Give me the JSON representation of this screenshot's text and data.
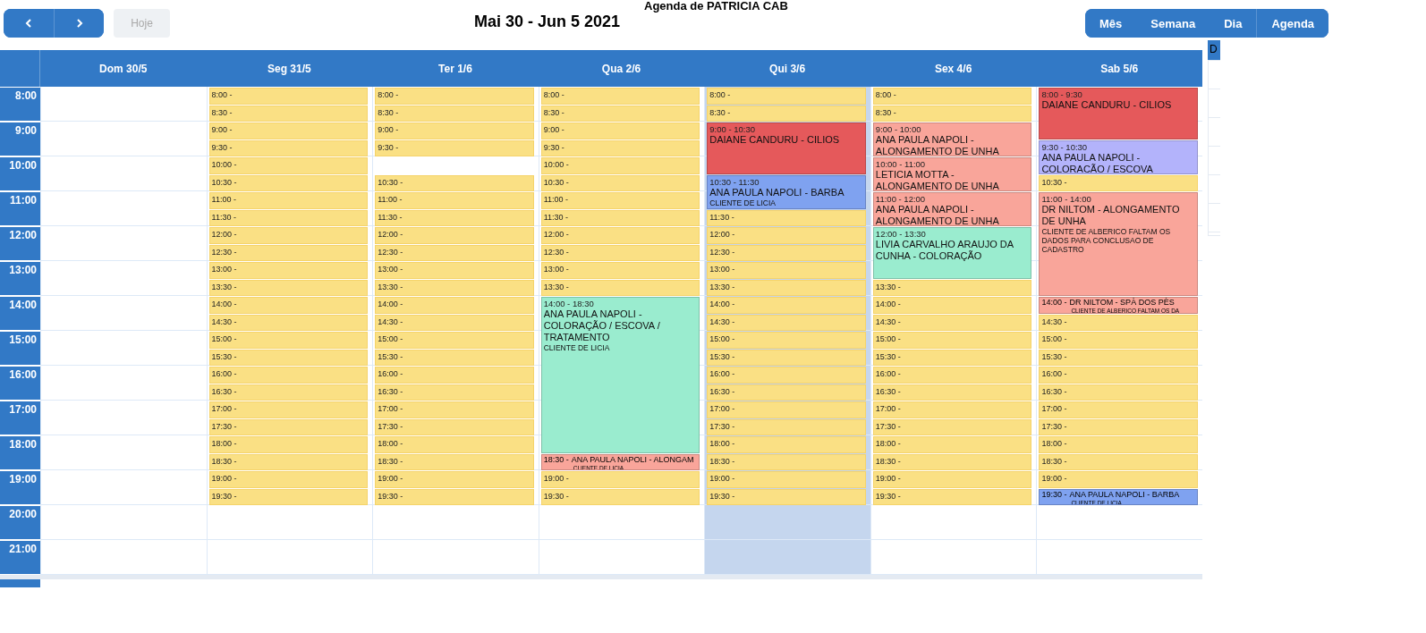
{
  "toolbar": {
    "agenda_title": "Agenda de PATRICIA CAB",
    "date_range": "Mai 30 - Jun 5 2021",
    "nav": [
      {
        "kind": "prev"
      },
      {
        "kind": "next"
      }
    ],
    "today_button": {
      "label": "Hoje",
      "disabled": true
    },
    "views": [
      {
        "label": "Mês"
      },
      {
        "label": "Semana"
      },
      {
        "label": "Dia"
      },
      {
        "label": "Agenda"
      }
    ]
  },
  "hours": [
    "8:00",
    "9:00",
    "10:00",
    "11:00",
    "12:00",
    "13:00",
    "14:00",
    "15:00",
    "16:00",
    "17:00",
    "18:00",
    "19:00",
    "20:00",
    "21:00"
  ],
  "days": [
    {
      "label": "Dom 30/5",
      "today": false
    },
    {
      "label": "Seg 31/5",
      "today": false,
      "events": [
        {
          "kind": "slot",
          "time": "8:00 -"
        },
        {
          "kind": "slot",
          "time": "8:30 -"
        },
        {
          "kind": "slot",
          "time": "9:00 -"
        },
        {
          "kind": "slot",
          "time": "9:30 -"
        },
        {
          "kind": "slot",
          "time": "10:00 -"
        },
        {
          "kind": "slot",
          "time": "10:30 -"
        },
        {
          "kind": "slot",
          "time": "11:00 -"
        },
        {
          "kind": "slot",
          "time": "11:30 -"
        },
        {
          "kind": "slot",
          "time": "12:00 -"
        },
        {
          "kind": "slot",
          "time": "12:30 -"
        },
        {
          "kind": "slot",
          "time": "13:00 -"
        },
        {
          "kind": "slot",
          "time": "13:30 -"
        },
        {
          "kind": "slot",
          "time": "14:00 -"
        },
        {
          "kind": "slot",
          "time": "14:30 -"
        },
        {
          "kind": "slot",
          "time": "15:00 -"
        },
        {
          "kind": "slot",
          "time": "15:30 -"
        },
        {
          "kind": "slot",
          "time": "16:00 -"
        },
        {
          "kind": "slot",
          "time": "16:30 -"
        },
        {
          "kind": "slot",
          "time": "17:00 -"
        },
        {
          "kind": "slot",
          "time": "17:30 -"
        },
        {
          "kind": "slot",
          "time": "18:00 -"
        },
        {
          "kind": "slot",
          "time": "18:30 -"
        },
        {
          "kind": "slot",
          "time": "19:00 -"
        },
        {
          "kind": "slot",
          "time": "19:30 -"
        }
      ]
    },
    {
      "label": "Ter 1/6",
      "today": false,
      "events": [
        {
          "kind": "slot",
          "time": "8:00 -"
        },
        {
          "kind": "slot",
          "time": "8:30 -"
        },
        {
          "kind": "slot",
          "time": "9:00 -"
        },
        {
          "kind": "slot",
          "time": "9:30 -"
        },
        {
          "kind": "slot",
          "time": "10:30 -"
        },
        {
          "kind": "slot",
          "time": "11:00 -"
        },
        {
          "kind": "slot",
          "time": "11:30 -"
        },
        {
          "kind": "slot",
          "time": "12:00 -"
        },
        {
          "kind": "slot",
          "time": "12:30 -"
        },
        {
          "kind": "slot",
          "time": "13:00 -"
        },
        {
          "kind": "slot",
          "time": "13:30 -"
        },
        {
          "kind": "slot",
          "time": "14:00 -"
        },
        {
          "kind": "slot",
          "time": "14:30 -"
        },
        {
          "kind": "slot",
          "time": "15:00 -"
        },
        {
          "kind": "slot",
          "time": "15:30 -"
        },
        {
          "kind": "slot",
          "time": "16:00 -"
        },
        {
          "kind": "slot",
          "time": "16:30 -"
        },
        {
          "kind": "slot",
          "time": "17:00 -"
        },
        {
          "kind": "slot",
          "time": "17:30 -"
        },
        {
          "kind": "slot",
          "time": "18:00 -"
        },
        {
          "kind": "slot",
          "time": "18:30 -"
        },
        {
          "kind": "slot",
          "time": "19:00 -"
        },
        {
          "kind": "slot",
          "time": "19:30 -"
        }
      ]
    },
    {
      "label": "Qua 2/6",
      "today": false,
      "events": [
        {
          "kind": "slot",
          "time": "8:00 -"
        },
        {
          "kind": "slot",
          "time": "8:30 -"
        },
        {
          "kind": "slot",
          "time": "9:00 -"
        },
        {
          "kind": "slot",
          "time": "9:30 -"
        },
        {
          "kind": "slot",
          "time": "10:00 -"
        },
        {
          "kind": "slot",
          "time": "10:30 -"
        },
        {
          "kind": "slot",
          "time": "11:00 -"
        },
        {
          "kind": "slot",
          "time": "11:30 -"
        },
        {
          "kind": "slot",
          "time": "12:00 -"
        },
        {
          "kind": "slot",
          "time": "12:30 -"
        },
        {
          "kind": "slot",
          "time": "13:00 -"
        },
        {
          "kind": "slot",
          "time": "13:30 -"
        },
        {
          "kind": "appointment",
          "time": "14:00 - 18:30",
          "title": "ANA PAULA NAPOLI - COLORAÇÃO / ESCOVA / TRATAMENTO",
          "note": "CLIENTE DE LICIA",
          "color": "#9aeccf"
        },
        {
          "kind": "short",
          "time": "18:30 -",
          "title": "ANA PAULA NAPOLI - ALONGAM",
          "note": "CLIENTE DE LICIA",
          "color": "#f9a59a"
        },
        {
          "kind": "slot",
          "time": "19:00 -"
        },
        {
          "kind": "slot",
          "time": "19:30 -"
        }
      ]
    },
    {
      "label": "Qui 3/6",
      "today": true,
      "events": [
        {
          "kind": "slot",
          "time": "8:00 -"
        },
        {
          "kind": "slot",
          "time": "8:30 -"
        },
        {
          "kind": "appointment",
          "time": "9:00 - 10:30",
          "title": "DAIANE CANDURU - CILIOS",
          "color": "#e5595b"
        },
        {
          "kind": "appointment",
          "time": "10:30 - 11:30",
          "title": "ANA PAULA NAPOLI - BARBA",
          "note": "CLIENTE DE LICIA",
          "color": "#7fa2f0"
        },
        {
          "kind": "slot",
          "time": "11:30 -"
        },
        {
          "kind": "slot",
          "time": "12:00 -"
        },
        {
          "kind": "slot",
          "time": "12:30 -"
        },
        {
          "kind": "slot",
          "time": "13:00 -"
        },
        {
          "kind": "slot",
          "time": "13:30 -"
        },
        {
          "kind": "slot",
          "time": "14:00 -"
        },
        {
          "kind": "slot",
          "time": "14:30 -"
        },
        {
          "kind": "slot",
          "time": "15:00 -"
        },
        {
          "kind": "slot",
          "time": "15:30 -"
        },
        {
          "kind": "slot",
          "time": "16:00 -"
        },
        {
          "kind": "slot",
          "time": "16:30 -"
        },
        {
          "kind": "slot",
          "time": "17:00 -"
        },
        {
          "kind": "slot",
          "time": "17:30 -"
        },
        {
          "kind": "slot",
          "time": "18:00 -"
        },
        {
          "kind": "slot",
          "time": "18:30 -"
        },
        {
          "kind": "slot",
          "time": "19:00 -"
        },
        {
          "kind": "slot",
          "time": "19:30 -"
        }
      ]
    },
    {
      "label": "Sex 4/6",
      "today": false,
      "events": [
        {
          "kind": "slot",
          "time": "8:00 -"
        },
        {
          "kind": "slot",
          "time": "8:30 -"
        },
        {
          "kind": "appointment",
          "time": "9:00 - 10:00",
          "title": "ANA PAULA NAPOLI - ALONGAMENTO DE UNHA",
          "color": "#f9a59a"
        },
        {
          "kind": "appointment",
          "time": "10:00 - 11:00",
          "title": "LETICIA MOTTA - ALONGAMENTO DE UNHA",
          "color": "#f9a59a"
        },
        {
          "kind": "appointment",
          "time": "11:00 - 12:00",
          "title": "ANA PAULA NAPOLI - ALONGAMENTO DE UNHA",
          "color": "#f9a59a"
        },
        {
          "kind": "appointment",
          "time": "12:00 - 13:30",
          "title": "LIVIA CARVALHO ARAUJO DA CUNHA - COLORAÇÃO",
          "color": "#9aeccf"
        },
        {
          "kind": "slot",
          "time": "13:30 -"
        },
        {
          "kind": "slot",
          "time": "14:00 -"
        },
        {
          "kind": "slot",
          "time": "14:30 -"
        },
        {
          "kind": "slot",
          "time": "15:00 -"
        },
        {
          "kind": "slot",
          "time": "15:30 -"
        },
        {
          "kind": "slot",
          "time": "16:00 -"
        },
        {
          "kind": "slot",
          "time": "16:30 -"
        },
        {
          "kind": "slot",
          "time": "17:00 -"
        },
        {
          "kind": "slot",
          "time": "17:30 -"
        },
        {
          "kind": "slot",
          "time": "18:00 -"
        },
        {
          "kind": "slot",
          "time": "18:30 -"
        },
        {
          "kind": "slot",
          "time": "19:00 -"
        },
        {
          "kind": "slot",
          "time": "19:30 -"
        }
      ]
    },
    {
      "label": "Sab 5/6",
      "today": false,
      "events": [
        {
          "kind": "appointment",
          "time": "8:00 - 9:30",
          "title": "DAIANE CANDURU - CILIOS",
          "color": "#e5595b"
        },
        {
          "kind": "appointment",
          "time": "9:30 - 10:30",
          "title": "ANA PAULA NAPOLI - COLORACÃO / ESCOVA",
          "color": "#b3b3fb"
        },
        {
          "kind": "slot",
          "time": "10:30 -"
        },
        {
          "kind": "appointment",
          "time": "11:00 - 14:00",
          "title": "DR NILTOM - ALONGAMENTO DE UNHA",
          "note": "CLIENTE DE ALBERICO FALTAM OS DADOS PARA CONCLUSAO DE CADASTRO",
          "color": "#f9a59a"
        },
        {
          "kind": "short",
          "time": "14:00 -",
          "title": "DR NILTOM - SPÀ DOS PÈS",
          "note": "CLIENTE DE ALBERICO FALTAM OS DA",
          "color": "#f9a59a"
        },
        {
          "kind": "slot",
          "time": "14:30 -"
        },
        {
          "kind": "slot",
          "time": "15:00 -"
        },
        {
          "kind": "slot",
          "time": "15:30 -"
        },
        {
          "kind": "slot",
          "time": "16:00 -"
        },
        {
          "kind": "slot",
          "time": "16:30 -"
        },
        {
          "kind": "slot",
          "time": "17:00 -"
        },
        {
          "kind": "slot",
          "time": "17:30 -"
        },
        {
          "kind": "slot",
          "time": "18:00 -"
        },
        {
          "kind": "slot",
          "time": "18:30 -"
        },
        {
          "kind": "slot",
          "time": "19:00 -"
        },
        {
          "kind": "short",
          "time": "19:30 -",
          "title": "ANA PAULA NAPOLI - BARBA",
          "note": "CLIENTE DE LICIA",
          "color": "#7fa2f0"
        }
      ]
    }
  ],
  "side_panel": {
    "header": "D"
  }
}
